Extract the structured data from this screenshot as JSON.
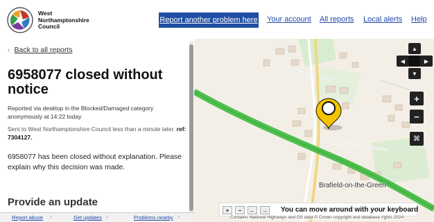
{
  "header": {
    "logo_line1": "West",
    "logo_line2": "Northamptonshire",
    "logo_line3": "Council",
    "nav": {
      "report_another": "Report another problem here",
      "your_account": "Your account",
      "all_reports": "All reports",
      "local_alerts": "Local alerts",
      "help": "Help"
    }
  },
  "sidebar": {
    "back_label": "Back to all reports",
    "title": "6958077 closed without notice",
    "reported": "Reported via desktop in the Blocked/Damaged category anonymously at 14:22 today",
    "sent_prefix": "Sent to West Northamptonshire Council less than a minute later.",
    "ref_label": "ref: 7304127.",
    "body": "6958077 has been closed without explanation. Please explain why this decision was made.",
    "provide_update": "Provide an update",
    "footer": {
      "report_abuse": "Report abuse",
      "get_updates": "Get updates",
      "problems_nearby": "Problems nearby"
    }
  },
  "map": {
    "place_label": "Brafield-on-the-Green",
    "keyboard_hint": "You can move around with your keyboard",
    "attribution": "Contains National Highways and OS data © Crown copyright and database rights 2024",
    "pin_color": "#f5c400",
    "road_color": "#4fbf4f"
  },
  "icons": {
    "pan": "pan-arrows-icon",
    "zoom_in": "plus-icon",
    "zoom_out": "minus-icon",
    "keys": "keyboard-icon"
  }
}
